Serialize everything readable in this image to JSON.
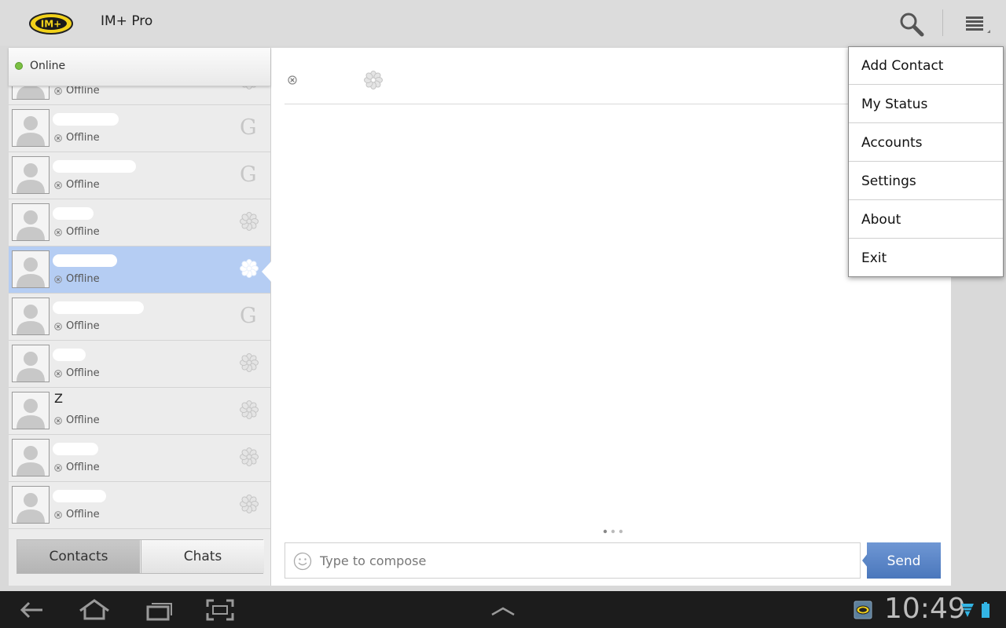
{
  "app": {
    "title": "IM+ Pro",
    "logo_text": "IM+"
  },
  "status": {
    "label": "Online",
    "color": "#7bc043"
  },
  "contacts": [
    {
      "name": "",
      "status": "Offline",
      "service": "icq",
      "selected": false
    },
    {
      "name": "",
      "status": "Offline",
      "service": "gtalk",
      "selected": false
    },
    {
      "name": "",
      "status": "Offline",
      "service": "gtalk",
      "selected": false
    },
    {
      "name": "",
      "status": "Offline",
      "service": "icq",
      "selected": false
    },
    {
      "name": "",
      "status": "Offline",
      "service": "icq",
      "selected": true
    },
    {
      "name": "",
      "status": "Offline",
      "service": "gtalk",
      "selected": false
    },
    {
      "name": "",
      "status": "Offline",
      "service": "icq",
      "selected": false
    },
    {
      "name": "Z",
      "status": "Offline",
      "service": "icq",
      "selected": false
    },
    {
      "name": "",
      "status": "Offline",
      "service": "icq",
      "selected": false
    },
    {
      "name": "",
      "status": "Offline",
      "service": "icq",
      "selected": false
    }
  ],
  "tabs": {
    "contacts": "Contacts",
    "chats": "Chats",
    "active": "contacts"
  },
  "compose": {
    "placeholder": "Type to compose",
    "value": "",
    "send_label": "Send"
  },
  "menu": {
    "items": [
      "Add Contact",
      "My Status",
      "Accounts",
      "Settings",
      "About",
      "Exit"
    ]
  },
  "system_bar": {
    "time": "10:49"
  },
  "icons": {
    "search": "search-icon",
    "menu": "overflow-menu-icon",
    "icq": "icq-flower-icon",
    "gtalk": "google-talk-icon",
    "offline": "offline-x-icon"
  },
  "colors": {
    "selected_row": "#b5cdf3",
    "send_button": "#5b86c5"
  }
}
